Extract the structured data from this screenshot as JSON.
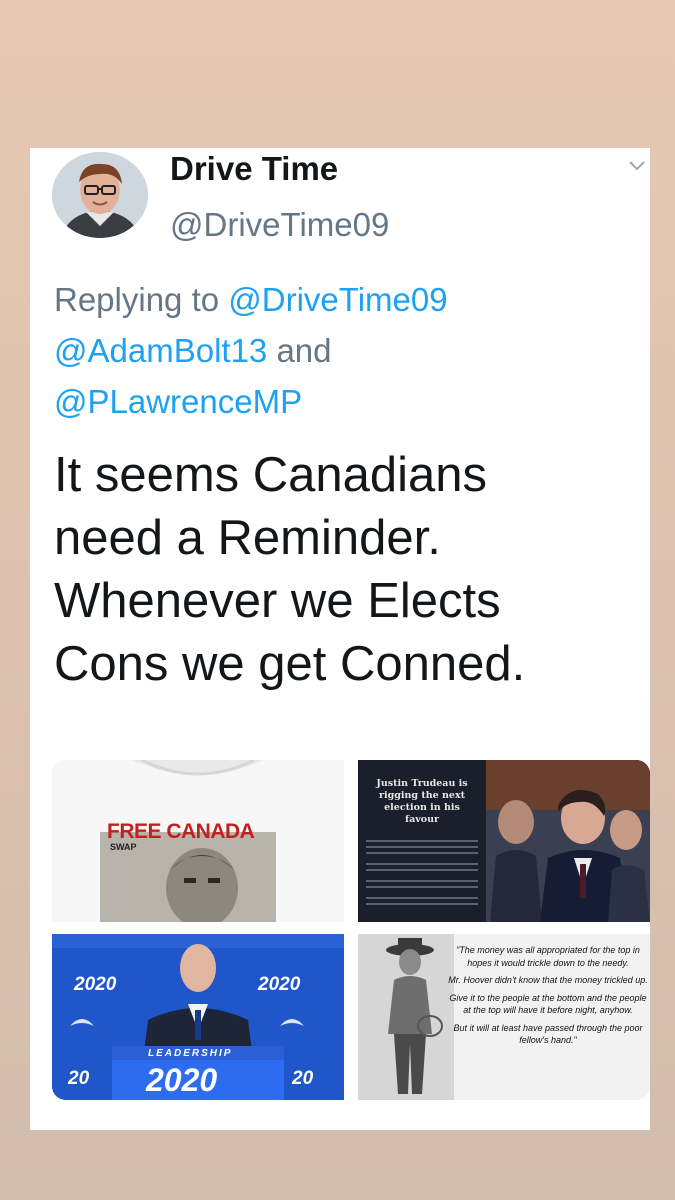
{
  "tweet": {
    "display_name": "Drive Time",
    "handle": "@DriveTime09",
    "reply_prefix": "Replying to",
    "reply_handle_1": "@DriveTime09",
    "reply_handle_2": "@AdamBolt13",
    "reply_joiner": "and",
    "reply_handle_3": "@PLawrenceMP",
    "text_line_1": "It seems Canadians",
    "text_line_2": "need a Reminder.",
    "text_line_3": "Whenever we Elects",
    "text_line_4": "Cons we get Conned."
  },
  "media": {
    "image_1": {
      "headline": "FREE CANADA",
      "subline": "SWAP"
    },
    "image_2": {
      "title_1": "Justin Trudeau is",
      "title_2": "rigging the next",
      "title_3": "election in his",
      "title_4": "favour"
    },
    "image_3": {
      "label_left": "2020",
      "label_right": "2020",
      "podium_top": "LEADERSHIP",
      "podium_main": "2020",
      "corner_left": "20",
      "corner_right": "20"
    },
    "image_4": {
      "quote_1": "\"The money was all appropriated for the top in hopes it would trickle down to the needy.",
      "quote_2": "Mr. Hoover didn't know that the money trickled up.",
      "quote_3": "Give it to the people at the bottom and the people at the top will have it before night, anyhow.",
      "quote_4": "But it will at least have passed through the poor fellow's hand.\""
    }
  },
  "colors": {
    "link": "#1da1f2",
    "secondary": "#657786",
    "text": "#14171a"
  },
  "icons": {
    "avatar": "avatar-photo",
    "menu": "chevron-down-icon"
  }
}
